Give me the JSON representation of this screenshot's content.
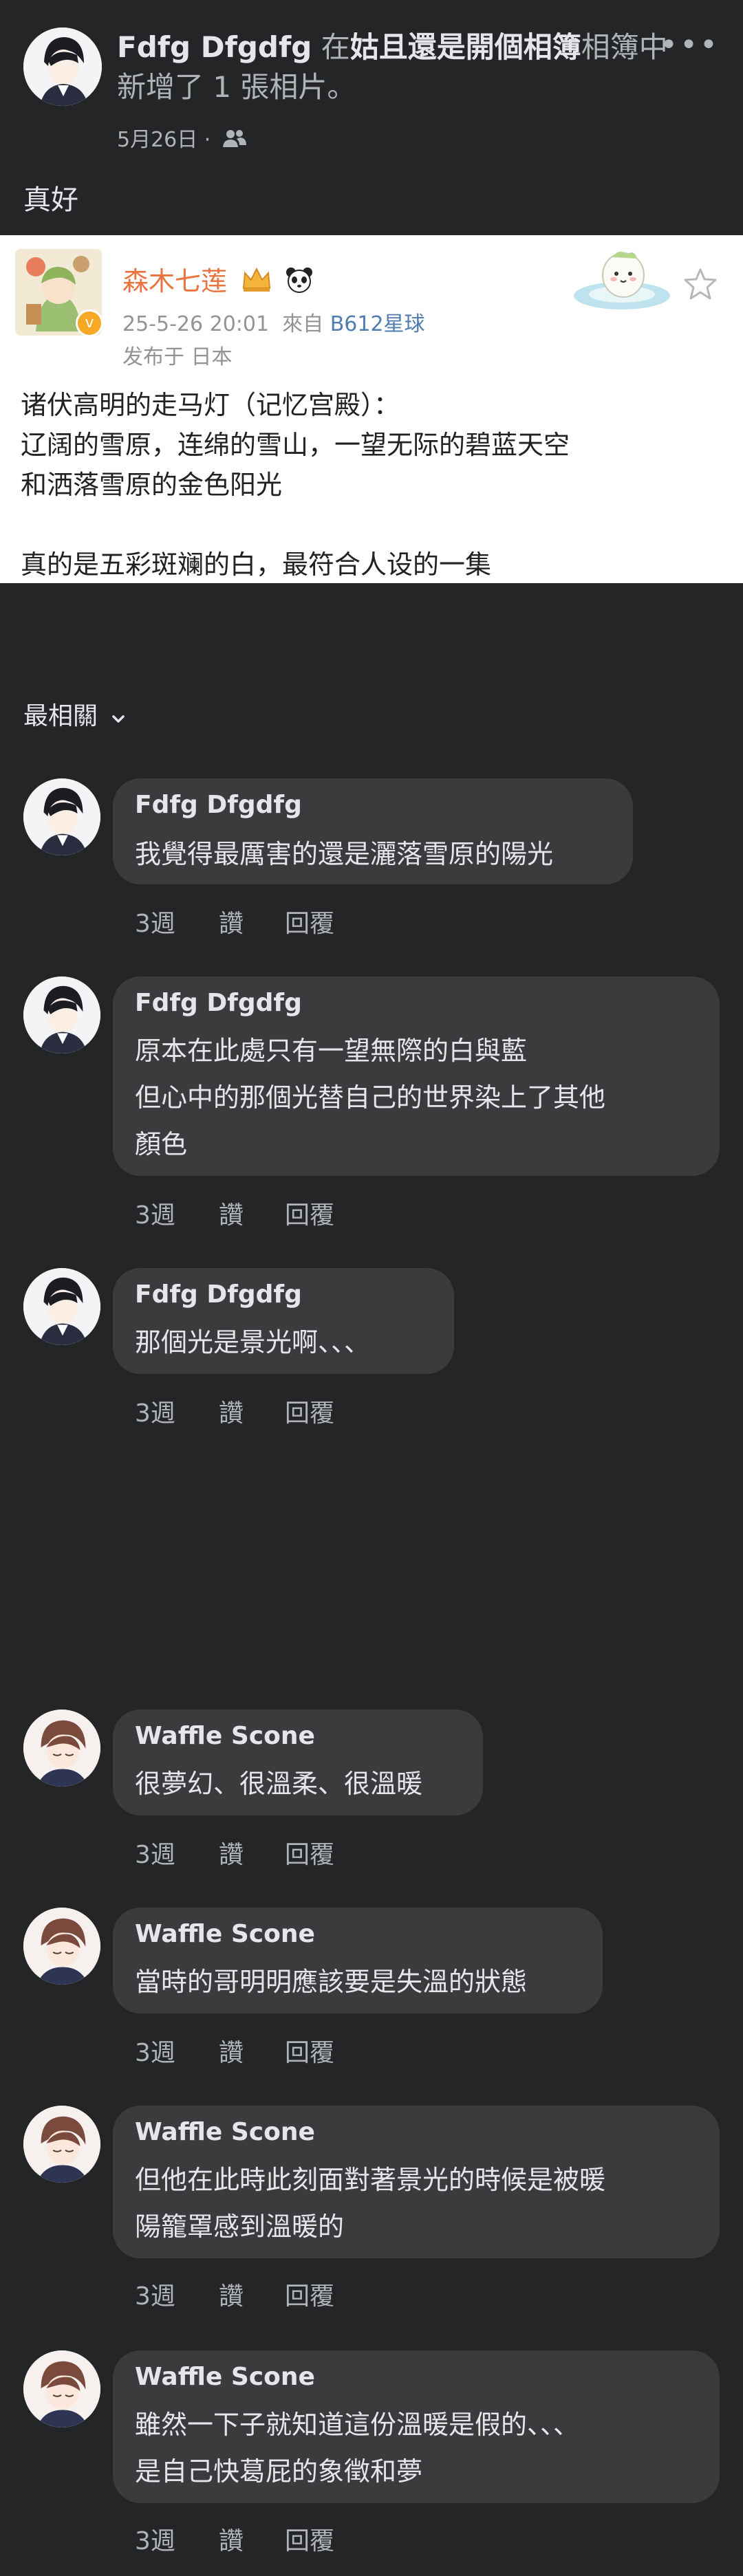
{
  "post": {
    "author": "Fdfg Dfgdfg",
    "action_prefix": "在",
    "album": "姑且還是開個相簿",
    "action_suffix": "相簿中新增了 1 張相片。",
    "date": "5月26日 ·",
    "audience_icon": "friends-icon",
    "more_icon": "more-dots-icon",
    "text": "真好"
  },
  "shared_card": {
    "author": "森木七莲",
    "badges": [
      "crown-badge-icon",
      "panda-icon"
    ],
    "verified_icon": "verified-badge-icon",
    "time": "25-5-26 20:01",
    "source_prefix": "來自",
    "source": "B612星球",
    "location": "发布于 日本",
    "star_icon": "star-icon",
    "lines": [
      "诸伏高明的走马灯（记忆宫殿）：",
      "辽阔的雪原，连绵的雪山，一望无际的碧蓝天空",
      "和洒落雪原的金色阳光",
      "",
      "真的是五彩斑斓的白，最符合人设的一集"
    ]
  },
  "sort": {
    "label": "最相關",
    "icon": "chevron-down-icon"
  },
  "comments": [
    {
      "author": "Fdfg Dfgdfg",
      "lines": [
        "我覺得最厲害的還是灑落雪原的陽光"
      ],
      "time": "3週",
      "like": "讚",
      "reply": "回覆"
    },
    {
      "author": "Fdfg Dfgdfg",
      "lines": [
        "原本在此處只有一望無際的白與藍",
        "但心中的那個光替自己的世界染上了其他",
        "顏色"
      ],
      "time": "3週",
      "like": "讚",
      "reply": "回覆"
    },
    {
      "author": "Fdfg Dfgdfg",
      "lines": [
        "那個光是景光啊、、、"
      ],
      "time": "3週",
      "like": "讚",
      "reply": "回覆"
    },
    {
      "author": "Waffle Scone",
      "lines": [
        "很夢幻、很溫柔、很溫暖"
      ],
      "time": "3週",
      "like": "讚",
      "reply": "回覆"
    },
    {
      "author": "Waffle Scone",
      "lines": [
        "當時的哥明明應該要是失溫的狀態"
      ],
      "time": "3週",
      "like": "讚",
      "reply": "回覆"
    },
    {
      "author": "Waffle Scone",
      "lines": [
        "但他在此時此刻面對著景光的時候是被暖",
        "陽籠罩感到溫暖的"
      ],
      "time": "3週",
      "like": "讚",
      "reply": "回覆"
    },
    {
      "author": "Waffle Scone",
      "lines": [
        "雖然一下子就知道這份溫暖是假的、、、",
        "是自己快葛屁的象徵和夢"
      ],
      "time": "3週",
      "like": "讚",
      "reply": "回覆"
    }
  ]
}
